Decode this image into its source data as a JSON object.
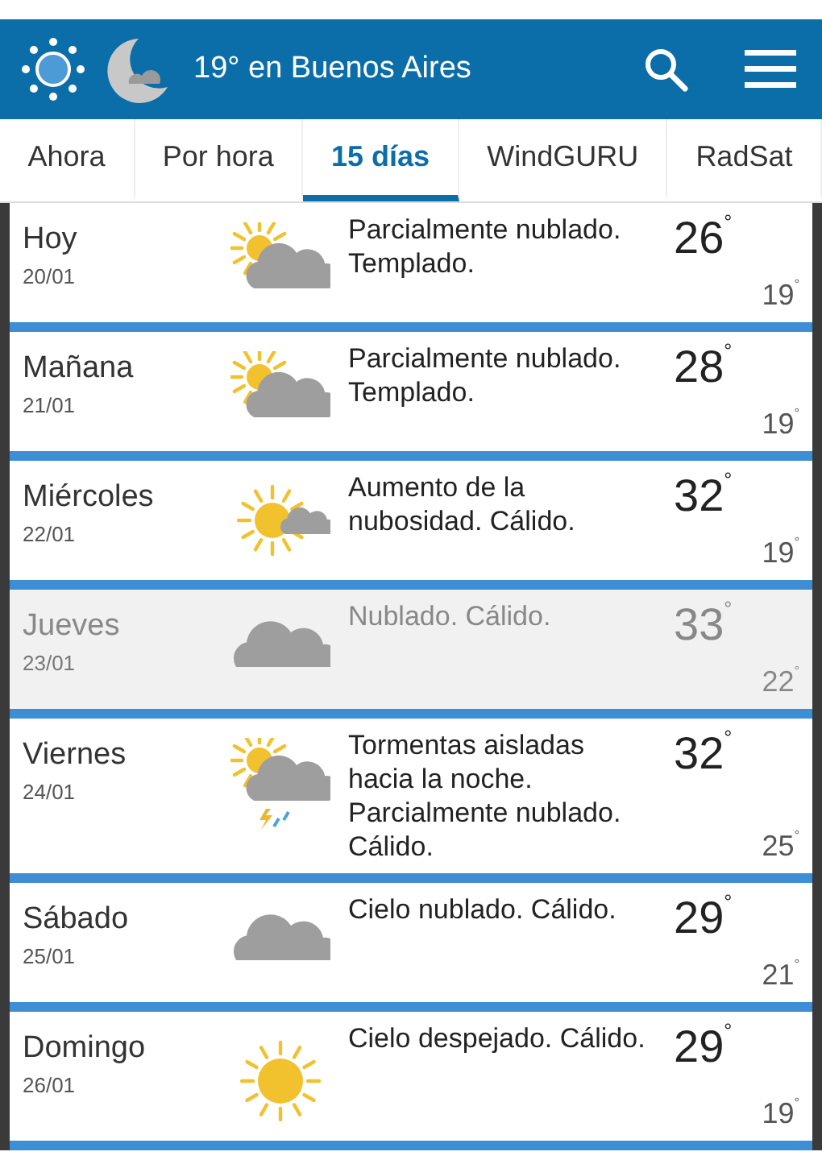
{
  "header": {
    "title": "19° en Buenos Aires"
  },
  "tabs": [
    {
      "label": "Ahora",
      "selected": false
    },
    {
      "label": "Por hora",
      "selected": false
    },
    {
      "label": "15 días",
      "selected": true
    },
    {
      "label": "WindGURU",
      "selected": false
    },
    {
      "label": "RadSat",
      "selected": false
    }
  ],
  "days": [
    {
      "day": "Hoy",
      "date": "20/01",
      "kind": "partly_cloudy",
      "description": "Parcialmente nublado. Templado.",
      "high": "26$^{°}$",
      "low": "19$^{°}$",
      "dimmed": false
    },
    {
      "day": "Mañana",
      "date": "21/01",
      "kind": "partly_cloudy",
      "description": "Parcialmente nublado. Templado.",
      "high": "28$^{°}$",
      "low": "19$^{°}$",
      "dimmed": false
    },
    {
      "day": "Miércoles",
      "date": "22/01",
      "kind": "sun_small_cloud",
      "description": "Aumento de la nubosidad. Cálido.",
      "high": "32$^{°}$",
      "low": "19$^{°}$",
      "dimmed": false
    },
    {
      "day": "Jueves",
      "date": "23/01",
      "kind": "cloudy",
      "description": "Nublado. Cálido.",
      "high": "33$^{°}$",
      "low": "22$^{°}$",
      "dimmed": true
    },
    {
      "day": "Viernes",
      "date": "24/01",
      "kind": "storm",
      "description": "Tormentas aisladas hacia la noche. Parcialmente nublado. Cálido.",
      "high": "32$^{°}$",
      "low": "25$^{°}$",
      "dimmed": false
    },
    {
      "day": "Sábado",
      "date": "25/01",
      "kind": "cloudy",
      "description": "Cielo nublado. Cálido.",
      "high": "29$^{°}$",
      "low": "21$^{°}$",
      "dimmed": false
    },
    {
      "day": "Domingo",
      "date": "26/01",
      "kind": "sunny",
      "description": "Cielo despejado. Cálido.",
      "high": "29$^{°}$",
      "low": "19$^{°}$",
      "dimmed": false
    }
  ]
}
